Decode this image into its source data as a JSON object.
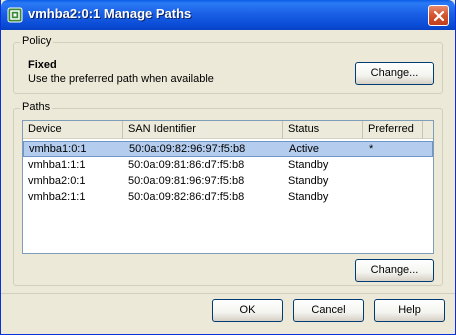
{
  "window": {
    "title": "vmhba2:0:1 Manage Paths"
  },
  "policy": {
    "legend": "Policy",
    "name": "Fixed",
    "description": "Use the preferred path when available",
    "change_label": "Change..."
  },
  "paths": {
    "legend": "Paths",
    "columns": [
      "Device",
      "SAN Identifier",
      "Status",
      "Preferred"
    ],
    "rows": [
      {
        "device": "vmhba1:0:1",
        "san": "50:0a:09:82:96:97:f5:b8",
        "status": "Active",
        "preferred": "*"
      },
      {
        "device": "vmhba1:1:1",
        "san": "50:0a:09:81:86:d7:f5:b8",
        "status": "Standby",
        "preferred": ""
      },
      {
        "device": "vmhba2:0:1",
        "san": "50:0a:09:81:96:97:f5:b8",
        "status": "Standby",
        "preferred": ""
      },
      {
        "device": "vmhba2:1:1",
        "san": "50:0a:09:82:86:d7:f5:b8",
        "status": "Standby",
        "preferred": ""
      }
    ],
    "change_label": "Change..."
  },
  "footer": {
    "ok_label": "OK",
    "cancel_label": "Cancel",
    "help_label": "Help"
  },
  "colors": {
    "titlebar": "#0a5ce8",
    "selection": "#b4cdee",
    "face": "#ece9d8"
  }
}
